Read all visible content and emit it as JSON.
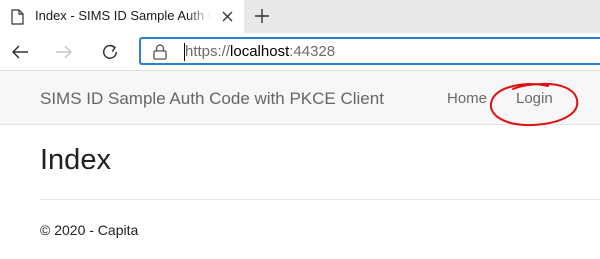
{
  "browser": {
    "tab": {
      "title": "Index - SIMS ID Sample Auth Code with PKCE Client",
      "icon": "page-icon"
    },
    "address_bar": {
      "scheme": "https://",
      "host": "localhost",
      "rest": ":44328",
      "secure_icon": "lock-icon"
    },
    "accent_color": "#2e7fd6"
  },
  "site": {
    "brand": "SIMS ID Sample Auth Code with PKCE Client",
    "nav": [
      {
        "label": "Home"
      },
      {
        "label": "Login"
      }
    ],
    "annotation_color": "#e01010"
  },
  "main": {
    "title": "Index"
  },
  "footer": {
    "text": "© 2020 - Capita"
  }
}
